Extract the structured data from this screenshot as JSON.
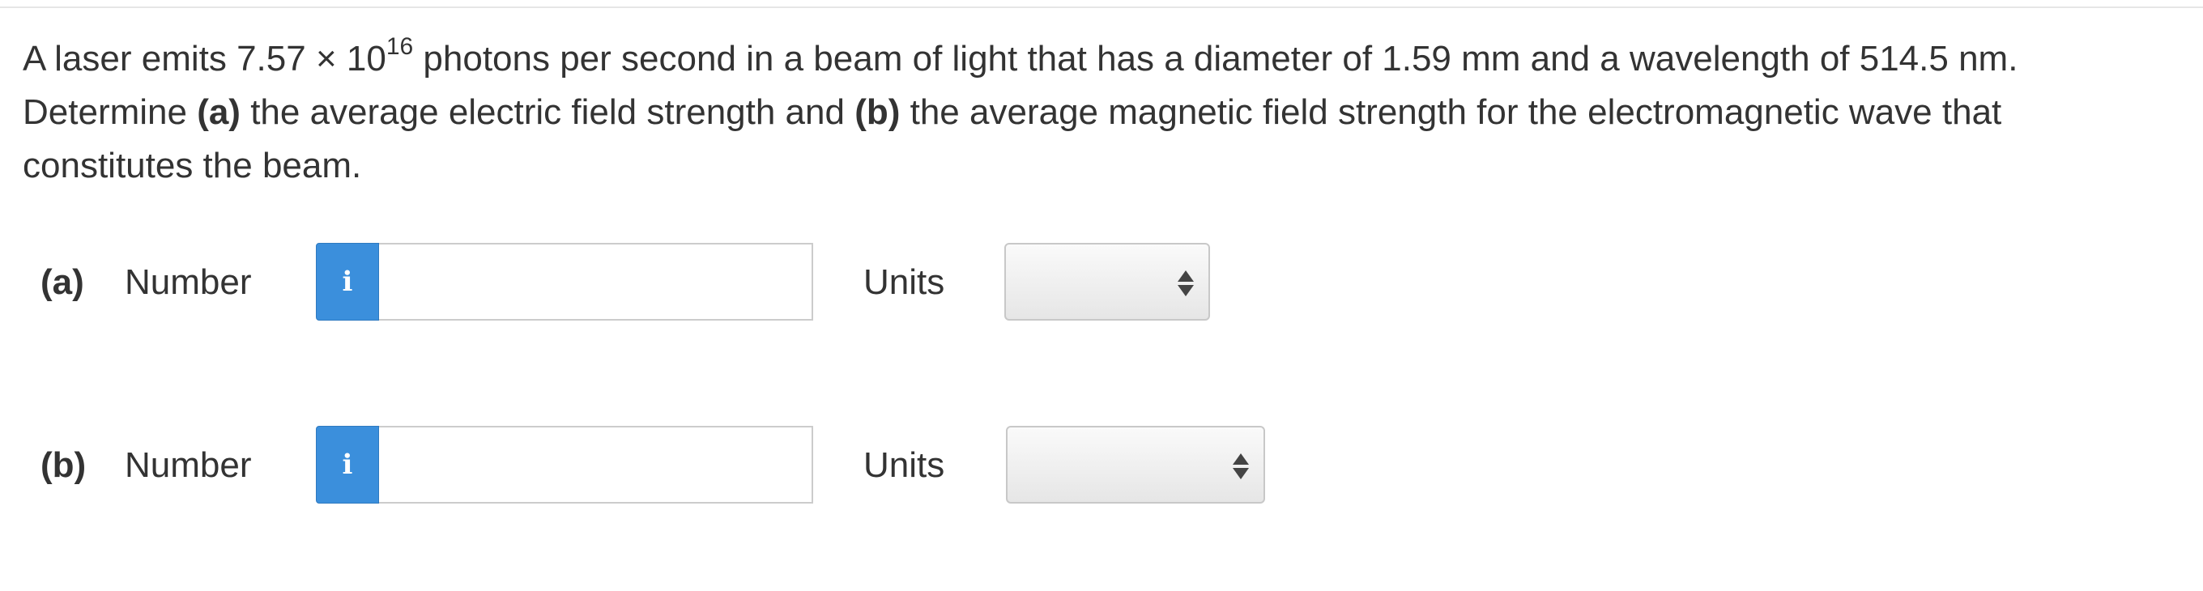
{
  "question": {
    "text_before_exp": "A laser emits 7.57 × 10",
    "exponent": "16",
    "text_after_exp": " photons per second in a beam of light that has a diameter of 1.59 mm and a wavelength of 514.5 nm. Determine ",
    "part_a_marker": "(a)",
    "part_a_text": " the average electric field strength and ",
    "part_b_marker": "(b)",
    "part_b_text": " the average magnetic field strength for the electromagnetic wave that constitutes the beam."
  },
  "parts": [
    {
      "label": "(a)",
      "number_label": "Number",
      "info_glyph": "i",
      "number_value": "",
      "units_label": "Units",
      "units_selected": ""
    },
    {
      "label": "(b)",
      "number_label": "Number",
      "info_glyph": "i",
      "number_value": "",
      "units_label": "Units",
      "units_selected": ""
    }
  ],
  "colors": {
    "info_button": "#3b8fdc",
    "text": "#333333"
  },
  "icons": {
    "info": "info-icon",
    "select_arrows": "up-down-arrows-icon"
  }
}
